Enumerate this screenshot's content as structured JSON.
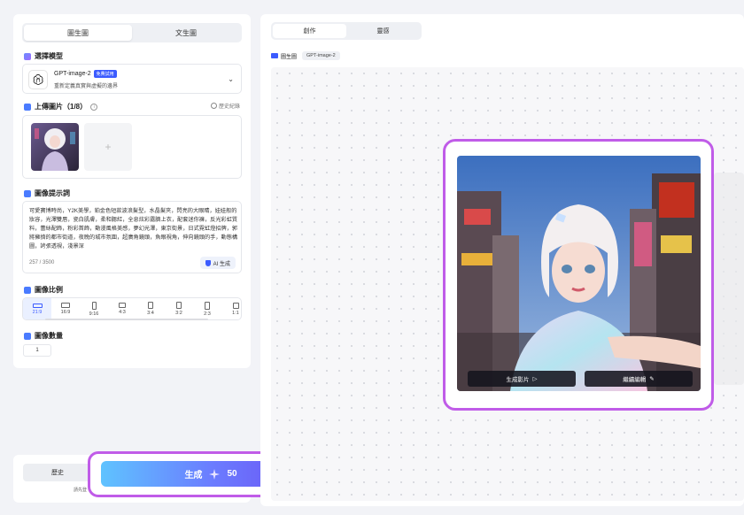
{
  "mode_tabs": [
    "圖生圖",
    "文生圖"
  ],
  "model": {
    "section_title": "選擇模型",
    "name": "GPT-image-2",
    "badge": "免費試用",
    "description": "重新定義真實與虛擬的邊界",
    "chevron_icon": "chevron-down-icon"
  },
  "upload": {
    "section_title": "上傳圖片（1/8）",
    "history_label": "歷史紀錄",
    "add_symbol": "+"
  },
  "prompt": {
    "section_title": "圖像提示詞",
    "text": "可愛寶博時尚，Y2K美學，鉑金色短款波浪髮型，水晶髮夾，閃亮的大眼睛，娃娃般的妝容，光澤雙唇，瓷白肌膚，柔和腮紅，全息炫彩露臍上衣，配套迷你褲，反光彩虹質料，蕾絲配飾，粉彩首飾，動漫風格美感，夢幻光澤，東京街景，日式霓虹燈招牌，郭將擁擠的都市街道，夜晚的城市氛圍，超廣角鏡頭，魚眼視角，伸向鏡頭的手，動態構圖，誇張透視，淺景深",
    "count": "257 / 3500",
    "ai_button": "AI 生成"
  },
  "ratio": {
    "section_title": "圖像比例",
    "items": [
      "21:9",
      "16:9",
      "9:16",
      "4:3",
      "3:4",
      "3:2",
      "2:3",
      "1:1"
    ],
    "selected": "21:9"
  },
  "quantity": {
    "section_title": "圖像數量",
    "value": "1"
  },
  "bottom": {
    "history_button": "歷史",
    "login_note": "請先登"
  },
  "generate": {
    "label": "生成",
    "cost": "50"
  },
  "right": {
    "tabs": [
      "創作",
      "靈感"
    ],
    "mode_label": "圖生圖",
    "model_tag": "GPT-image-2"
  },
  "result_card": {
    "video_button": "生成影片",
    "edit_button": "繼續編輯"
  },
  "colors": {
    "accent": "#3b5bff",
    "highlight_outline": "#c05ce8"
  }
}
